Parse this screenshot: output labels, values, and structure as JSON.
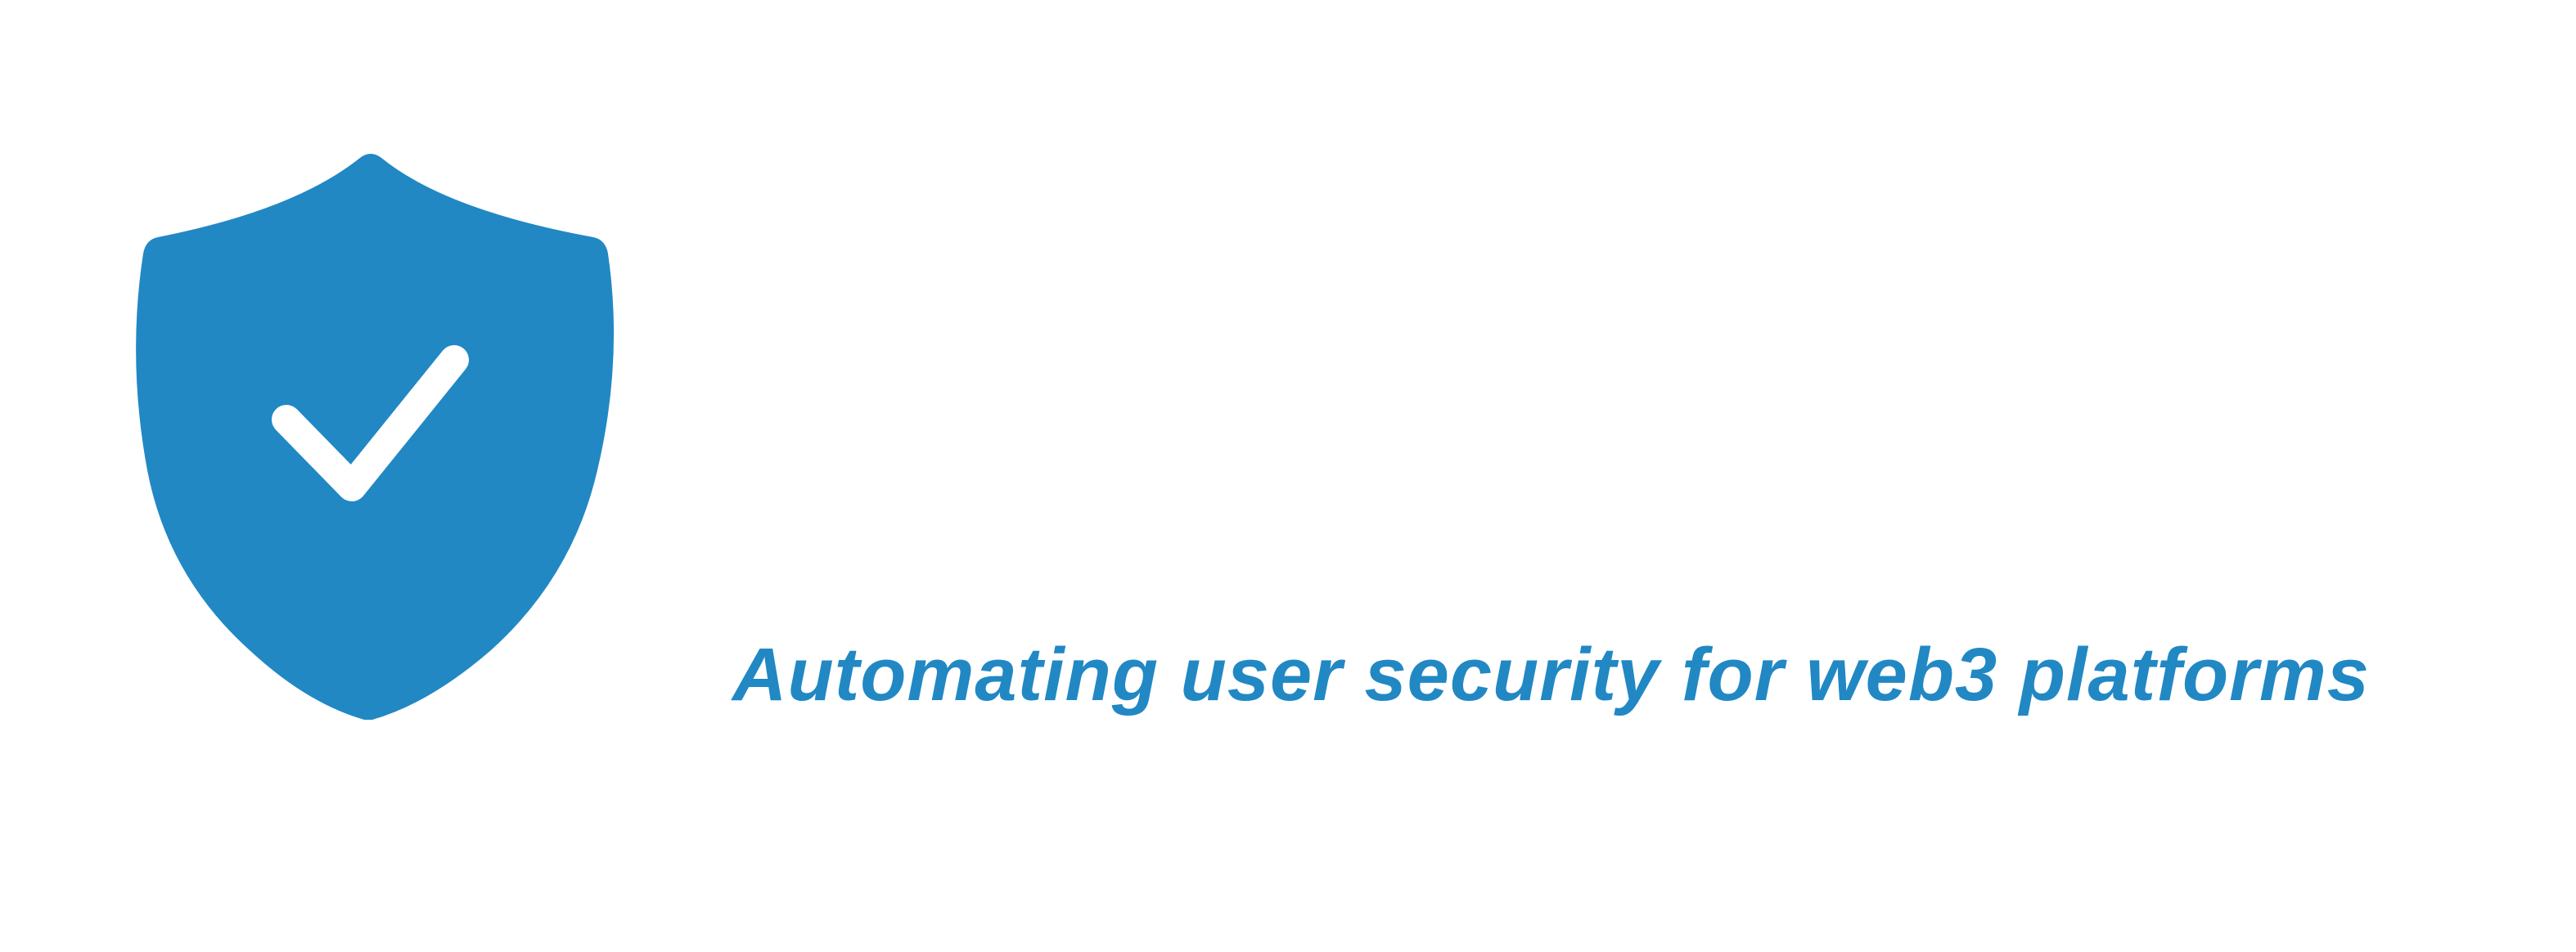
{
  "brand": {
    "tagline": "Automating user security for web3 platforms",
    "icon": "shield-check-icon",
    "color": "#2188C4",
    "check_color": "#FFFFFF",
    "background": "#FFFFFF"
  }
}
